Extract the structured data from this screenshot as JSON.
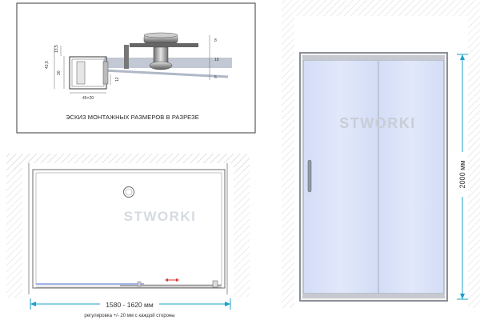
{
  "section": {
    "caption": "ЭСКИЗ МОНТАЖНЫХ РАЗМЕРОВ В РАЗРЕЗЕ",
    "dims": {
      "d43_5": "43,5",
      "d13_5": "13,5",
      "d30": "30",
      "d12": "12",
      "d45x20": "45×20",
      "d8": "8",
      "d19": "19",
      "d6": "6"
    }
  },
  "plan": {
    "width_label": "1580 - 1620 мм",
    "adjust_note": "регулировка +/- 20 мм с каждой стороны"
  },
  "elevation": {
    "height_label": "2000 мм"
  },
  "brand": {
    "watermark": "STWORKI"
  },
  "colors": {
    "accent_cyan": "#1aa0c8",
    "glass_blue": "#d9e2f7",
    "frame_gray": "#8a8f98",
    "border_gray": "#555555",
    "arrow_red": "#d9302b"
  }
}
